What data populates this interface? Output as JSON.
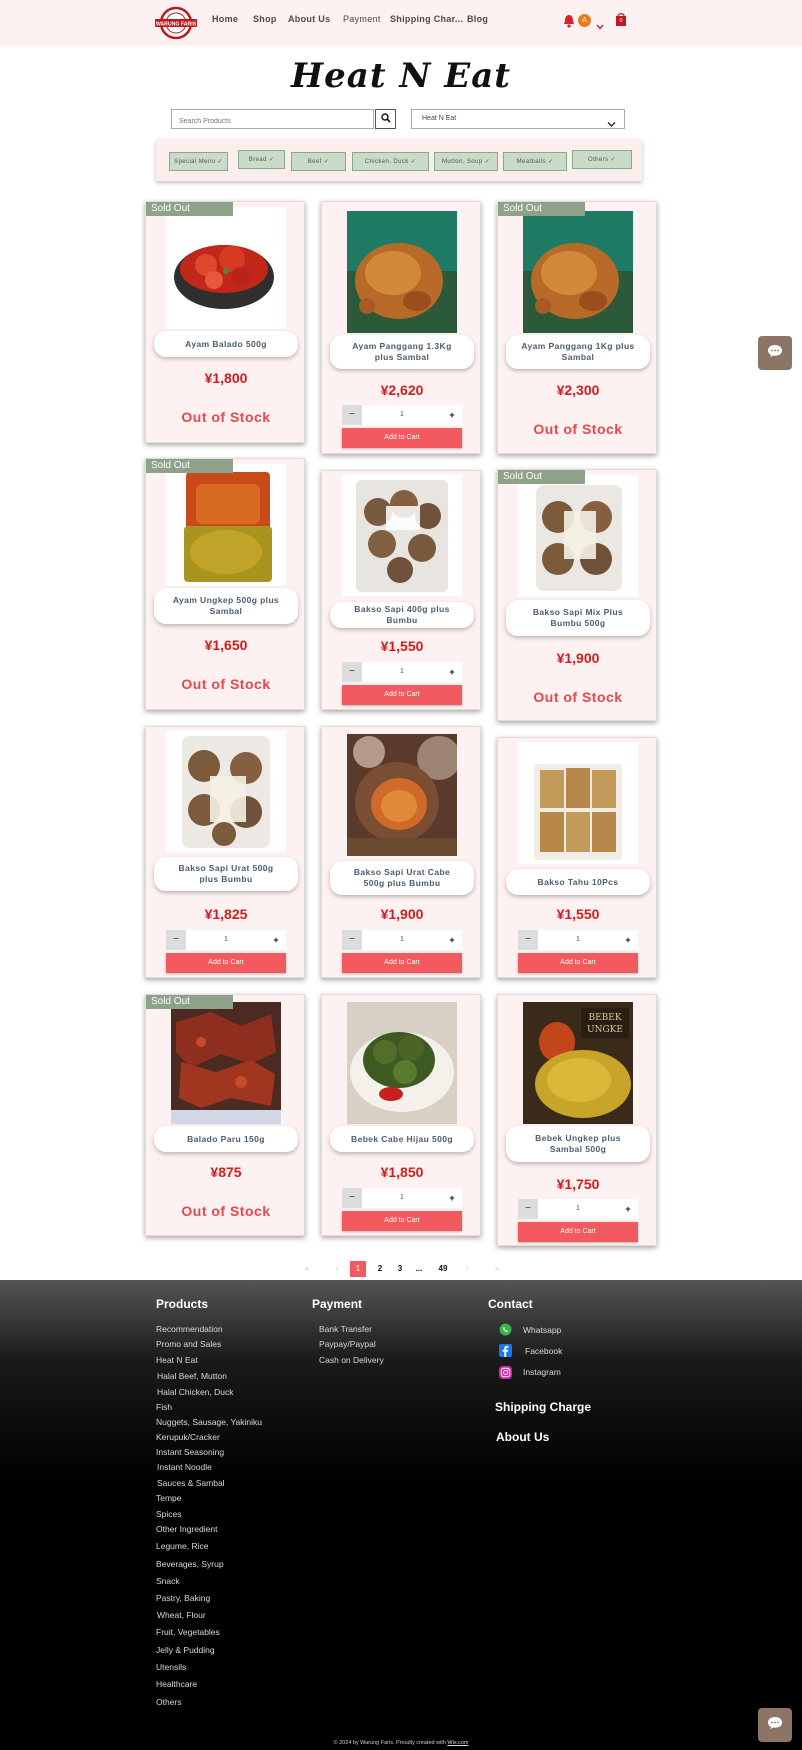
{
  "header": {
    "logo_text": "WARUNG FARIS",
    "nav": [
      "Home",
      "Shop",
      "About Us",
      "Payment",
      "Shipping Char...",
      "Blog"
    ],
    "avatar_letter": "A",
    "cart_count": "0"
  },
  "page": {
    "title": "Heat N Eat"
  },
  "search": {
    "placeholder": "Search Products"
  },
  "category_select": {
    "value": "Heat N Eat"
  },
  "chips": [
    "Special Menu",
    "Bread",
    "Beef",
    "Chicken, Duck",
    "Mutton, Soup",
    "Meatballs",
    "Others"
  ],
  "labels": {
    "sold_out": "Sold Out",
    "out_of_stock": "Out of Stock",
    "add_to_cart": "Add to Cart",
    "qty_default": "1",
    "minus": "−",
    "plus": "+"
  },
  "products": [
    {
      "name": "Ayam Balado 500g",
      "price": "¥1,800",
      "sold_out": true
    },
    {
      "name": "Ayam Panggang 1.3Kg plus Sambal",
      "price": "¥2,620",
      "sold_out": false
    },
    {
      "name": "Ayam Panggang 1Kg plus Sambal",
      "price": "¥2,300",
      "sold_out": true
    },
    {
      "name": "Ayam Ungkep 500g plus Sambal",
      "price": "¥1,650",
      "sold_out": true
    },
    {
      "name": "Bakso Sapi 400g plus Bumbu",
      "price": "¥1,550",
      "sold_out": false
    },
    {
      "name": "Bakso Sapi Mix Plus Bumbu 500g",
      "price": "¥1,900",
      "sold_out": true
    },
    {
      "name": "Bakso Sapi Urat 500g plus Bumbu",
      "price": "¥1,825",
      "sold_out": false
    },
    {
      "name": "Bakso Sapi Urat Cabe 500g plus Bumbu",
      "price": "¥1,900",
      "sold_out": false
    },
    {
      "name": "Bakso Tahu 10Pcs",
      "price": "¥1,550",
      "sold_out": false
    },
    {
      "name": "Balado Paru 150g",
      "price": "¥875",
      "sold_out": true
    },
    {
      "name": "Bebek Cabe Hijau 500g",
      "price": "¥1,850",
      "sold_out": false
    },
    {
      "name": "Bebek Ungkep plus Sambal 500g",
      "price": "¥1,750",
      "sold_out": false
    }
  ],
  "pagination": {
    "first": "«",
    "prev": "‹",
    "pages": [
      "1",
      "2",
      "3"
    ],
    "ellipsis": "...",
    "last_page": "49",
    "next": "›",
    "last": "»",
    "current": "1"
  },
  "footer": {
    "products_heading": "Products",
    "product_links": [
      "Recommendation",
      "Promo and Sales",
      "Heat N Eat",
      "Halal Beef, Mutton",
      "Halal Chicken, Duck",
      "Fish",
      "Nuggets, Sausage, Yakiniku",
      "Kerupuk/Cracker",
      "Instant Seasoning",
      "Instant Noodle",
      "Sauces & Sambal",
      "Tempe",
      "Spices",
      "Other Ingredient",
      "Legume, Rice",
      "Beverages, Syrup",
      "Snack",
      "Pastry, Baking",
      "Wheat, Flour",
      "Fruit, Vegetables",
      "Jelly & Pudding",
      "Utensils",
      "Healthcare",
      "Others"
    ],
    "payment_heading": "Payment",
    "payment_links": [
      "Bank Transfer",
      "Paypay/Paypal",
      "Cash on Delivery"
    ],
    "contact_heading": "Contact",
    "contact_links": [
      "Whatsapp",
      "Facebook",
      "Instagram"
    ],
    "shipping_charge": "Shipping Charge",
    "about_us": "About Us",
    "copyright": "© 2024 by Warung Faris. Proudly created with",
    "wix": "Wix.com"
  },
  "colors": {
    "header_bg": "#fdf1f1",
    "accent_red": "#f25a5f",
    "price_red": "#d21c1c",
    "sold_tag": "#8ea28a",
    "chip_green": "#c9dbc9"
  },
  "icons": [
    "search-icon",
    "bell-icon",
    "chevron-down-icon",
    "cart-icon",
    "chat-icon",
    "whatsapp-icon",
    "facebook-icon",
    "instagram-icon"
  ]
}
